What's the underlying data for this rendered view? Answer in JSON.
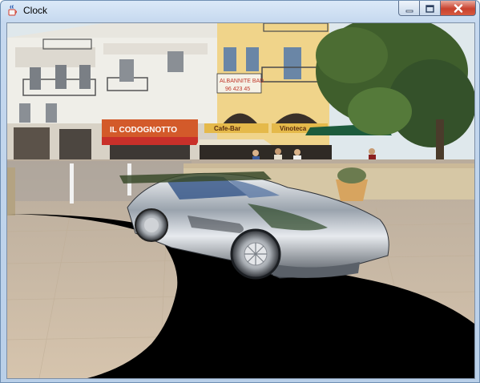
{
  "window": {
    "title": "Clock",
    "app_icon": "java-coffee-cup-icon",
    "buttons": {
      "minimize_icon": "minimize-icon",
      "maximize_icon": "maximize-icon",
      "close_icon": "close-icon"
    }
  },
  "scene": {
    "signs": {
      "shop1": "IL CODOGNOTTO",
      "shop2": "Cafe-Bar",
      "shop3": "Vinoteca",
      "hanging_sign_line1": "ALBANNITE BAD",
      "hanging_sign_line2": "96 423 45"
    }
  },
  "colors": {
    "sky": "#dce8f0",
    "building_white": "#f1f0ea",
    "building_yellow": "#f0d48a",
    "pavement": "#cdbba4",
    "shadow": "#000000",
    "car_chrome": "#c5c9cf",
    "titlebar_top": "#dbe9f8",
    "close_red": "#c8412e"
  }
}
